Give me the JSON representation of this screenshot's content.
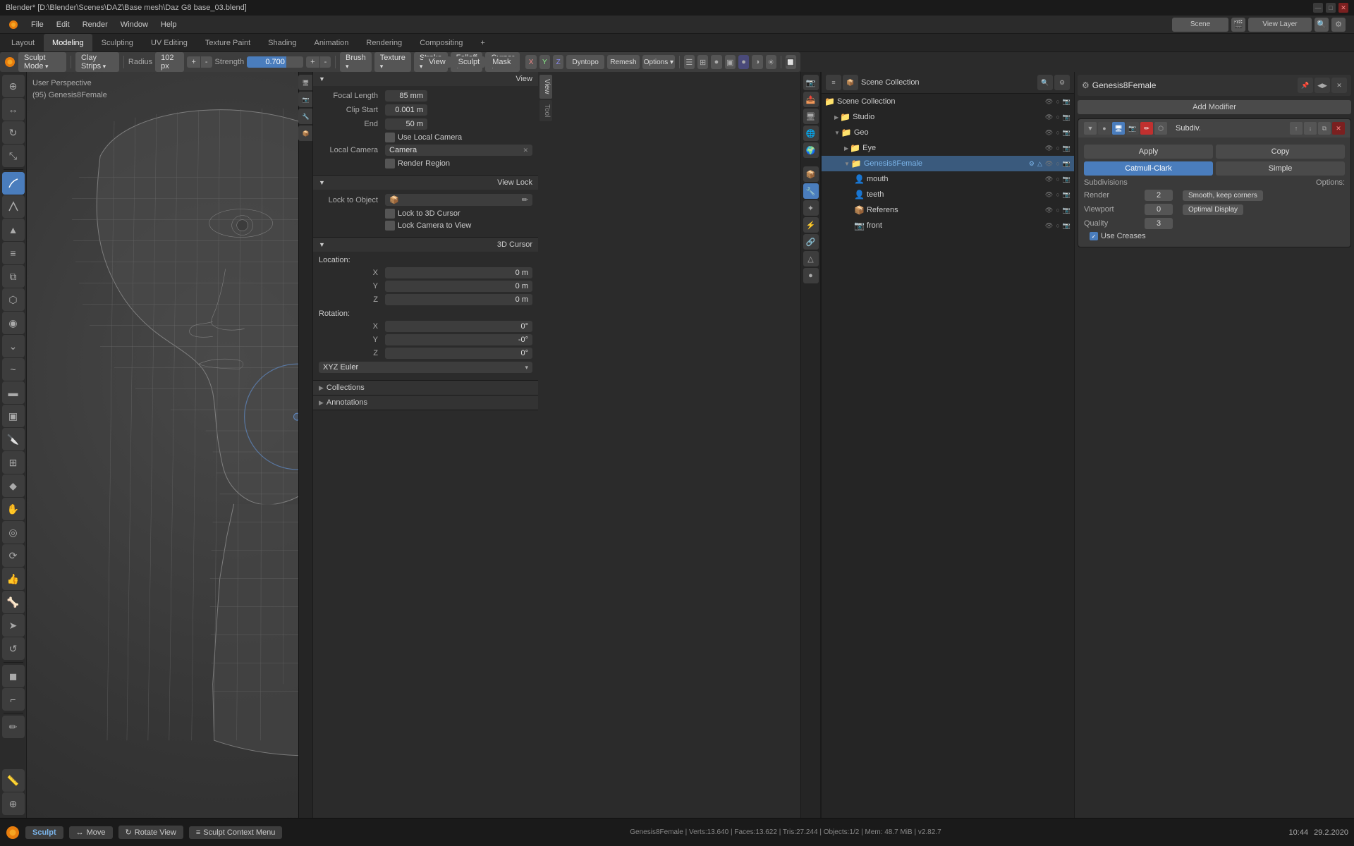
{
  "titleBar": {
    "title": "Blender* [D:\\Blender\\Scenes\\DAZ\\Base mesh\\Daz G8 base_03.blend]",
    "windowControls": [
      "—",
      "□",
      "✕"
    ]
  },
  "menuBar": {
    "items": [
      "Blender",
      "File",
      "Edit",
      "Render",
      "Window",
      "Help"
    ],
    "activeItem": ""
  },
  "workspaceTabs": {
    "tabs": [
      "Layout",
      "Modeling",
      "Sculpting",
      "UV Editing",
      "Texture Paint",
      "Shading",
      "Animation",
      "Rendering",
      "Compositing",
      "+"
    ],
    "activeTab": "Modeling"
  },
  "toolbar": {
    "brushName": "Clay Strips",
    "radiusLabel": "Radius",
    "radiusValue": "102 px",
    "strengthLabel": "Strength",
    "strengthValue": "0.700",
    "brushBtn": "Brush",
    "textureBtn": "Texture",
    "strokeBtn": "Stroke",
    "falloffBtn": "Falloff",
    "cursorBtn": "Cursor",
    "sculptMode": "Sculpt Mode",
    "viewBtn": "View",
    "sculptBtn": "Sculpt",
    "maskBtn": "Mask"
  },
  "viewport": {
    "label": "User Perspective",
    "objectName": "(95) Genesis8Female",
    "overlay": {
      "perspective": "User Perspective",
      "object": "(95) Genesis8Female"
    }
  },
  "nPanel": {
    "view": {
      "title": "View",
      "focalLength": "85 mm",
      "clipStart": "0.001 m",
      "clipEnd": "50 m",
      "useLocalCamera": "Use Local Camera",
      "localCamera": "Local Camera",
      "camera": "Camera",
      "renderRegion": "Render Region"
    },
    "viewLock": {
      "title": "View Lock",
      "lockToObject": "Lock to Object",
      "lockTo3DCursor": "Lock to 3D Cursor",
      "lockCameraToView": "Lock Camera to View"
    },
    "cursor3D": {
      "title": "3D Cursor",
      "locationLabel": "Location:",
      "x": "0 m",
      "y": "0 m",
      "z": "0 m",
      "rotationLabel": "Rotation:",
      "rx": "0°",
      "ry": "-0°",
      "rz": "0°",
      "rotationMode": "XYZ Euler"
    },
    "collections": {
      "title": "Collections"
    },
    "annotations": {
      "title": "Annotations"
    }
  },
  "sceneCollection": {
    "title": "Scene Collection",
    "items": [
      {
        "name": "Scene Collection",
        "indent": 0,
        "expanded": true,
        "icon": "📁"
      },
      {
        "name": "Studio",
        "indent": 1,
        "expanded": true,
        "icon": "⚙"
      },
      {
        "name": "Geo",
        "indent": 1,
        "expanded": true,
        "icon": "📦"
      },
      {
        "name": "Eye",
        "indent": 2,
        "expanded": false,
        "icon": "👁"
      },
      {
        "name": "Genesis8Female",
        "indent": 2,
        "expanded": true,
        "icon": "👤",
        "active": true
      },
      {
        "name": "mouth",
        "indent": 3,
        "expanded": false,
        "icon": "📦"
      },
      {
        "name": "teeth",
        "indent": 3,
        "expanded": false,
        "icon": "📦"
      },
      {
        "name": "Referens",
        "indent": 3,
        "expanded": false,
        "icon": "📦"
      },
      {
        "name": "front",
        "indent": 3,
        "expanded": false,
        "icon": "📷"
      }
    ]
  },
  "modifierPanel": {
    "objectName": "Genesis8Female",
    "addModifierBtn": "Add Modifier",
    "modifier": {
      "name": "Subdiv.",
      "applyBtn": "Apply",
      "copyBtn": "Copy",
      "catmullClarkBtn": "Catmull-Clark",
      "simpleBtn": "Simple",
      "subdivisionsLabel": "Subdivisions",
      "optionsLabel": "Options:",
      "renderLabel": "Render",
      "renderValue": "2",
      "renderOption": "Smooth, keep corners",
      "viewportLabel": "Viewport",
      "viewportValue": "0",
      "viewportOption": "Optimal Display",
      "qualityLabel": "Quality",
      "qualityValue": "3",
      "useCreases": "Use Creases"
    }
  },
  "statusBar": {
    "sculptBtn": "Sculpt",
    "moveBtn": "Move",
    "rotateViewBtn": "Rotate View",
    "sculptContextMenuBtn": "Sculpt Context Menu",
    "info": "Genesis8Female | Verts:13.640 | Faces:13.622 | Tris:27.244 | Objects:1/2 | Mem: 48.7 MiB | v2.82.7",
    "time": "10:44",
    "date": "29.2.2020"
  },
  "icons": {
    "transform": "↔",
    "sculpt": "◎",
    "cursor": "⊕",
    "smooth": "~",
    "grab": "✋",
    "flatten": "▬",
    "crease": "⌄",
    "pinch": "◆",
    "inflate": "⬡",
    "clay": "▲",
    "clayStrips": "≡",
    "layer": "⧉",
    "mask": "◼",
    "drawFace": "⬟",
    "gear": "⚙",
    "eye": "👁",
    "render": "📷",
    "output": "📤",
    "view": "🖥",
    "scene": "🌐",
    "world": "🌍",
    "object": "📦",
    "modifier": "🔧",
    "particle": "✦",
    "physics": "⚡",
    "constraint": "🔗",
    "data": "△",
    "material": "●",
    "shading": "◑"
  },
  "colors": {
    "accent": "#4a7dbd",
    "bg": "#2b2b2b",
    "panel": "#3a3a3a",
    "header": "#333",
    "active": "#4a7dbd",
    "selected": "#3a5a7d",
    "red": "#c05050"
  }
}
